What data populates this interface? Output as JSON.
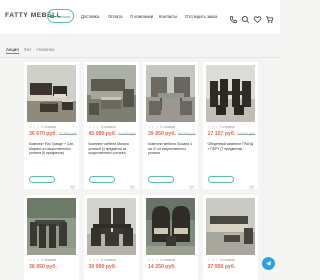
{
  "header": {
    "logo": "FATTY MEBELL",
    "catalog_label": "Каталог",
    "nav": [
      "Доставка",
      "Оплата",
      "О компании",
      "Контакты",
      "Отследить заказ"
    ],
    "icons": [
      "phone-icon",
      "search-icon",
      "heart-icon",
      "cart-icon"
    ]
  },
  "tabs": [
    "Акция",
    "Хит",
    "Новинка"
  ],
  "active_tab": "Акция",
  "products": [
    {
      "meta": [
        "☆ ☆ ☆",
        "0 отзывов"
      ],
      "price": "36 670 руб.",
      "old_price": "52 386 руб.",
      "title": "Комплект Рио Гранде + Сан-Марино из искусственного ротанга (6 предметов)"
    },
    {
      "meta": [
        "☆ ☆ ☆",
        "0 отзывов"
      ],
      "price": "45 080 руб.",
      "old_price": "64 400 руб.",
      "title": "Комплект мебели Мальта угловой (4 предмета) из искусственного ротанга"
    },
    {
      "meta": [
        "☆ ☆ ☆",
        "0 отзывов"
      ],
      "price": "39 850 руб.",
      "old_price": "56 929 руб.",
      "title": "Комплект мебели Тоскана 4 на 4+ из искусственного ротанга"
    },
    {
      "meta": [
        "☆ ☆ ☆",
        "0 отзывов"
      ],
      "price": "17 157 руб.",
      "old_price": "24 510 руб.",
      "title": "Обеденный комплект ГРАНД + ПЕРУ (7 предметов)"
    },
    {
      "meta": [
        "☆ ☆ ☆",
        "0 отзывов"
      ],
      "price": "38 950 руб.",
      "old_price": "",
      "title": ""
    },
    {
      "meta": [
        "☆ ☆ ☆",
        "0 отзывов"
      ],
      "price": "36 990 руб.",
      "old_price": "",
      "title": ""
    },
    {
      "meta": [
        "☆ ☆ ☆",
        "0 отзывов"
      ],
      "price": "14 250 руб.",
      "old_price": "",
      "title": ""
    },
    {
      "meta": [
        "☆ ☆ ☆",
        "0 отзывов"
      ],
      "price": "27 950 руб.",
      "old_price": "",
      "title": ""
    }
  ],
  "colors": {
    "accent": "#3aa38c",
    "price": "#e7664a",
    "telegram": "#2fa3d9"
  }
}
